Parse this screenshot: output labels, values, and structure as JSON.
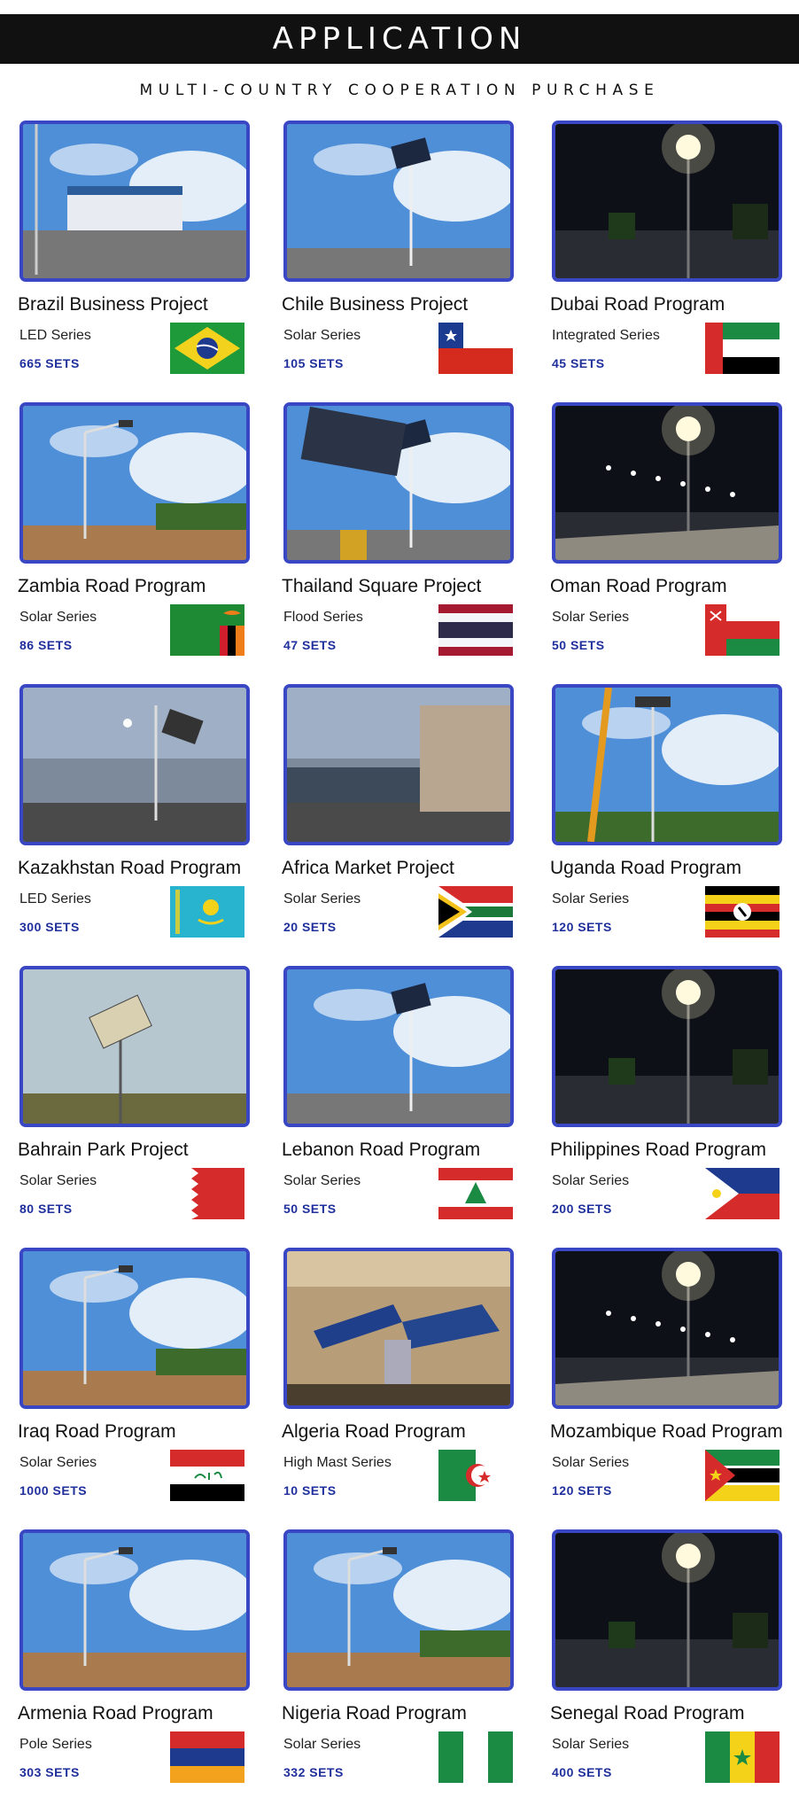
{
  "header": {
    "title": "APPLICATION",
    "subtitle": "MULTI-COUNTRY COOPERATION PURCHASE"
  },
  "projects": [
    {
      "name": "Brazil Business Project",
      "series": "LED Series",
      "sets": "665 SETS",
      "flag": "brazil-flag",
      "scene": "day-building"
    },
    {
      "name": "Chile Business Project",
      "series": "Solar Series",
      "sets": "105 SETS",
      "flag": "chile-flag",
      "scene": "day-solar"
    },
    {
      "name": "Dubai Road Program",
      "series": "Integrated Series",
      "sets": "45 SETS",
      "flag": "uae-flag",
      "scene": "night-lamp"
    },
    {
      "name": "Zambia Road Program",
      "series": "Solar Series",
      "sets": "86 SETS",
      "flag": "zambia-flag",
      "scene": "day-road"
    },
    {
      "name": "Thailand Square Project",
      "series": "Flood Series",
      "sets": "47 SETS",
      "flag": "thailand-flag",
      "scene": "day-solar-close"
    },
    {
      "name": "Oman Road Program",
      "series": "Solar Series",
      "sets": "50 SETS",
      "flag": "oman-flag",
      "scene": "night-road"
    },
    {
      "name": "Kazakhstan Road Program",
      "series": "LED Series",
      "sets": "300 SETS",
      "flag": "kazakhstan-flag",
      "scene": "dusk-solar"
    },
    {
      "name": "Africa Market Project",
      "series": "Solar Series",
      "sets": "20 SETS",
      "flag": "south-africa-flag",
      "scene": "dusk-building"
    },
    {
      "name": "Uganda Road Program",
      "series": "Solar Series",
      "sets": "120 SETS",
      "flag": "uganda-flag",
      "scene": "day-crane"
    },
    {
      "name": "Bahrain Park Project",
      "series": "Solar Series",
      "sets": "80 SETS",
      "flag": "bahrain-flag",
      "scene": "day-park"
    },
    {
      "name": "Lebanon Road Program",
      "series": "Solar Series",
      "sets": "50 SETS",
      "flag": "lebanon-flag",
      "scene": "day-solar"
    },
    {
      "name": "Philippines Road Program",
      "series": "Solar Series",
      "sets": "200 SETS",
      "flag": "philippines-flag",
      "scene": "night-lamp"
    },
    {
      "name": "Iraq Road Program",
      "series": "Solar Series",
      "sets": "1000 SETS",
      "flag": "iraq-flag",
      "scene": "day-road"
    },
    {
      "name": "Algeria Road Program",
      "series": "High Mast Series",
      "sets": "10 SETS",
      "flag": "algeria-flag",
      "scene": "workshop"
    },
    {
      "name": "Mozambique Road Program",
      "series": "Solar Series",
      "sets": "120 SETS",
      "flag": "mozambique-flag",
      "scene": "night-road"
    },
    {
      "name": "Armenia Road Program",
      "series": "Pole Series",
      "sets": "303 SETS",
      "flag": "armenia-flag",
      "scene": "blue-sky-pole"
    },
    {
      "name": "Nigeria Road Program",
      "series": "Solar Series",
      "sets": "332 SETS",
      "flag": "nigeria-flag",
      "scene": "day-road"
    },
    {
      "name": "Senegal Road Program",
      "series": "Solar Series",
      "sets": "400 SETS",
      "flag": "senegal-flag",
      "scene": "night-lamp"
    }
  ],
  "colors": {
    "header_bg": "#111111",
    "frame": "#3a47c4",
    "sets_text": "#1f2f9c"
  }
}
